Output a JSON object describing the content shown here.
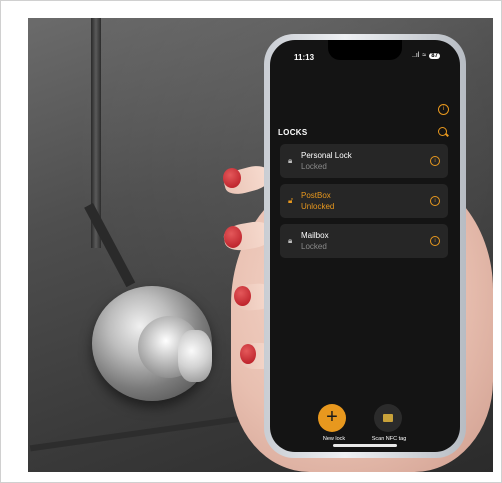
{
  "status_bar": {
    "time": "11:13",
    "signal": "..ıl",
    "wifi": "≈",
    "battery": "87"
  },
  "header": {
    "title": "LOCKS",
    "info_icon": "info-icon",
    "search_icon": "search-icon"
  },
  "locks": [
    {
      "name": "Personal Lock",
      "state": "Locked",
      "icon": "padlock-closed-icon",
      "color": "#bdbdbd"
    },
    {
      "name": "PostBox",
      "state": "Unlocked",
      "icon": "padlock-open-icon",
      "color": "#e8981e"
    },
    {
      "name": "Mailbox",
      "state": "Locked",
      "icon": "padlock-closed-icon",
      "color": "#bdbdbd"
    }
  ],
  "actions": {
    "new_lock_label": "New lock",
    "new_lock_icon": "plus-icon",
    "scan_label": "Scan NFC tag",
    "scan_icon": "nfc-tag-icon"
  },
  "colors": {
    "accent": "#e8981e",
    "screen_bg": "#141414",
    "card_bg": "#262626"
  }
}
